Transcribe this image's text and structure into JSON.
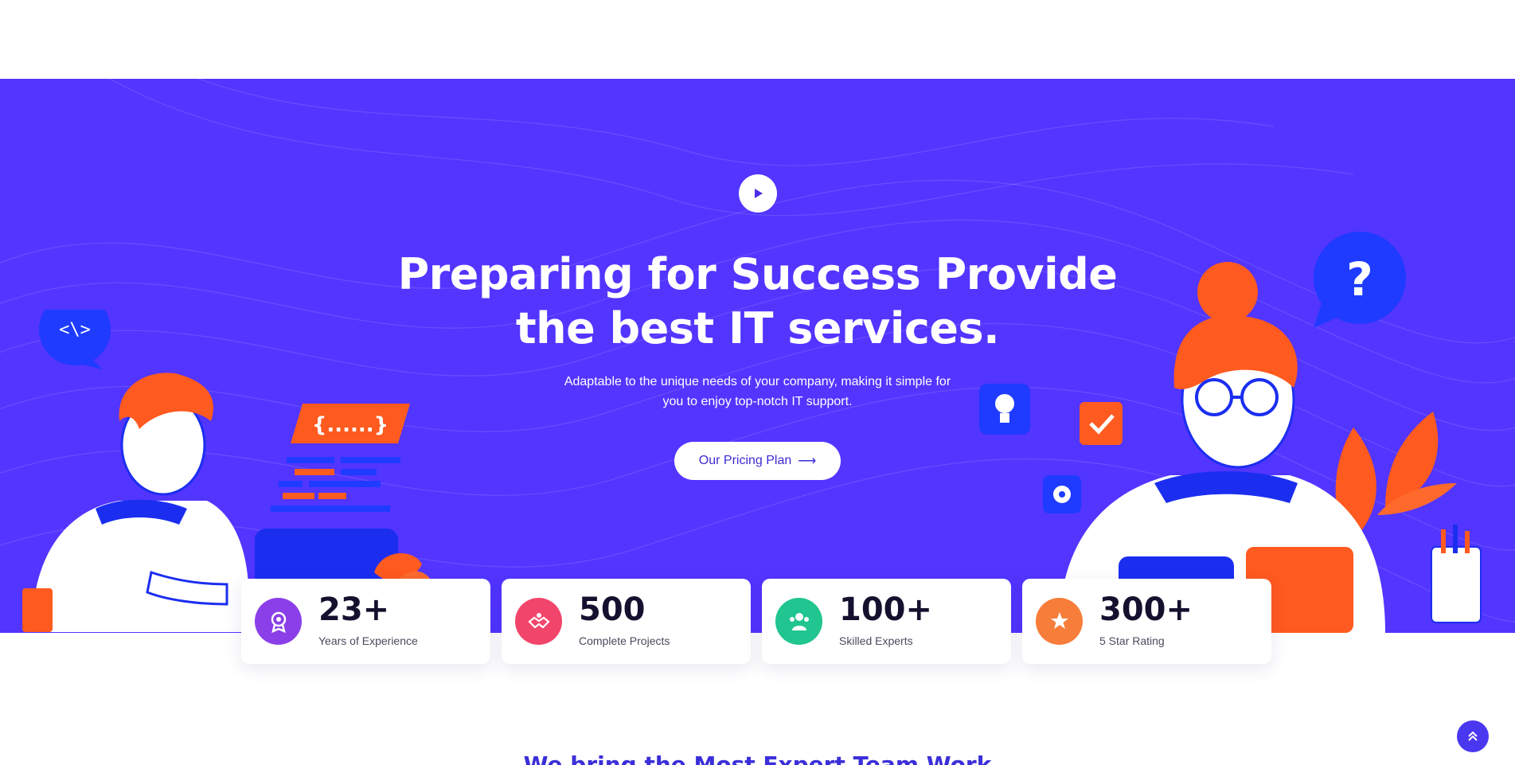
{
  "hero": {
    "title_line1": "Preparing for Success Provide",
    "title_line2": "the best IT services.",
    "subtitle_line1": "Adaptable to the unique needs of your company, making it simple for",
    "subtitle_line2": "you to enjoy top-notch IT support.",
    "cta_label": "Our Pricing Plan",
    "cta_arrow": "⟶",
    "play_icon": "play-icon",
    "bg_color": "#5235FF"
  },
  "illustration": {
    "code_tag": "<\\>",
    "code_braces": "{......}",
    "question_mark": "?"
  },
  "stats": [
    {
      "value": "23+",
      "label": "Years of Experience",
      "icon": "award-icon",
      "color": "#8A3FE8"
    },
    {
      "value": "500",
      "label": "Complete Projects",
      "icon": "handshake-icon",
      "color": "#F2456B"
    },
    {
      "value": "100+",
      "label": "Skilled Experts",
      "icon": "team-icon",
      "color": "#20C58F"
    },
    {
      "value": "300+",
      "label": "5 Star Rating",
      "icon": "star-badge-icon",
      "color": "#F77D3A"
    }
  ],
  "section": {
    "title_partial": "We bring the Most Expert Team Work"
  },
  "scroll_top": {
    "icon": "double-chevron-up-icon"
  }
}
